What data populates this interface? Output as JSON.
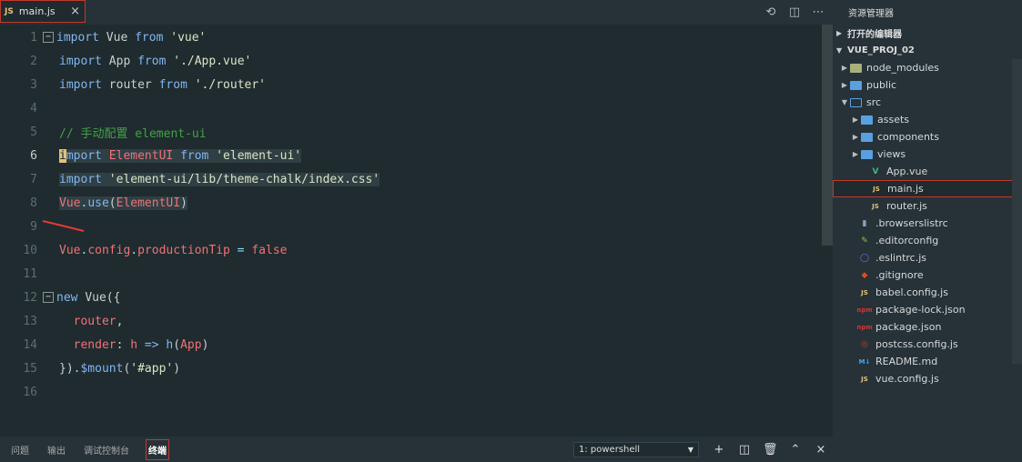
{
  "editor": {
    "tab": {
      "lang_badge": "JS",
      "filename": "main.js",
      "close": "×"
    },
    "actions": [
      {
        "name": "compare-icon",
        "glyph": "⟲"
      },
      {
        "name": "split-editor-icon",
        "glyph": "◫"
      },
      {
        "name": "more-actions-icon",
        "glyph": "⋯"
      }
    ],
    "lines": [
      {
        "n": "1",
        "fold": "−"
      },
      {
        "n": "2"
      },
      {
        "n": "3"
      },
      {
        "n": "4"
      },
      {
        "n": "5"
      },
      {
        "n": "6"
      },
      {
        "n": "7"
      },
      {
        "n": "8"
      },
      {
        "n": "9"
      },
      {
        "n": "10"
      },
      {
        "n": "11"
      },
      {
        "n": "12",
        "fold": "−"
      },
      {
        "n": "13"
      },
      {
        "n": "14"
      },
      {
        "n": "15"
      },
      {
        "n": "16"
      }
    ],
    "code": {
      "l1": {
        "kw1": "import",
        "id": "Vue",
        "kw2": "from",
        "str": "'vue'"
      },
      "l2": {
        "kw1": "import",
        "id": "App",
        "kw2": "from",
        "str": "'./App.vue'"
      },
      "l3": {
        "kw1": "import",
        "id": "router",
        "kw2": "from",
        "str": "'./router'"
      },
      "l5": {
        "comment_slash": "//",
        "comment": " 手动配置 element-ui"
      },
      "l6": {
        "kw1a": "i",
        "kw1b": "mport",
        "id": "ElementUI",
        "kw2": "from",
        "str": "'element-ui'"
      },
      "l7": {
        "kw1": "import",
        "str": "'element-ui/lib/theme-chalk/index.css'"
      },
      "l8": {
        "obj": "Vue",
        "dot": ".",
        "fn": "use",
        "p1": "(",
        "arg": "ElementUI",
        "p2": ")"
      },
      "l10": {
        "obj": "Vue",
        "dot1": ".",
        "prop1": "config",
        "dot2": ".",
        "prop2": "productionTip",
        "eq": " = ",
        "val": "false"
      },
      "l12": {
        "kw": "new",
        "id": "Vue",
        "tail": "({"
      },
      "l13": {
        "prop": "router",
        "comma": ","
      },
      "l14": {
        "prop": "render",
        "colon": ": ",
        "arg": "h",
        "arrow": " => ",
        "fn": "h",
        "p1": "(",
        "inner": "App",
        "p2": ")"
      },
      "l15": {
        "close": "})",
        "dot": ".",
        "fn": "$mount",
        "p1": "(",
        "str": "'#app'",
        "p2": ")"
      }
    }
  },
  "sidebar": {
    "title": "资源管理器",
    "open_editors": "打开的编辑器",
    "project": "VUE_PROJ_02",
    "items": [
      {
        "label": "node_modules",
        "type": "folder-nm"
      },
      {
        "label": "public",
        "type": "folder"
      },
      {
        "label": "src",
        "type": "folder-open"
      },
      {
        "label": "assets",
        "type": "folder"
      },
      {
        "label": "components",
        "type": "folder"
      },
      {
        "label": "views",
        "type": "folder"
      },
      {
        "label": "App.vue",
        "type": "vue"
      },
      {
        "label": "main.js",
        "type": "js"
      },
      {
        "label": "router.js",
        "type": "js"
      },
      {
        "label": ".browserslistrc",
        "type": "file"
      },
      {
        "label": ".editorconfig",
        "type": "editorconfig"
      },
      {
        "label": ".eslintrc.js",
        "type": "eslint"
      },
      {
        "label": ".gitignore",
        "type": "git"
      },
      {
        "label": "babel.config.js",
        "type": "js"
      },
      {
        "label": "package-lock.json",
        "type": "npm"
      },
      {
        "label": "package.json",
        "type": "npm"
      },
      {
        "label": "postcss.config.js",
        "type": "postcss"
      },
      {
        "label": "README.md",
        "type": "md"
      },
      {
        "label": "vue.config.js",
        "type": "js"
      }
    ]
  },
  "panel": {
    "tabs": [
      "问题",
      "输出",
      "调试控制台",
      "终端"
    ],
    "terminal_select": "1: powershell",
    "actions": [
      "+",
      "◫",
      "🗑",
      "⌃",
      "×"
    ]
  },
  "colors": {
    "accent_red": "#c0392b",
    "editor_bg": "#1f2b2e",
    "sidebar_bg": "#263238"
  }
}
